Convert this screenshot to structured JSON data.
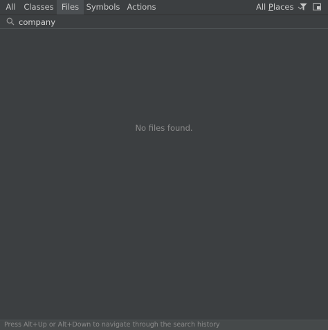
{
  "tabs": [
    {
      "label": "All",
      "selected": false
    },
    {
      "label": "Classes",
      "selected": false
    },
    {
      "label": "Files",
      "selected": true
    },
    {
      "label": "Symbols",
      "selected": false
    },
    {
      "label": "Actions",
      "selected": false
    }
  ],
  "scope": {
    "prefix": "All ",
    "underlined": "P",
    "suffix": "laces"
  },
  "toolbar": {
    "filter_icon": "filter-icon",
    "preview_icon": "preview-icon"
  },
  "search": {
    "value": "company",
    "icon": "search-icon"
  },
  "results": {
    "empty_message": "No files found."
  },
  "footer": {
    "hint": "Press Alt+Up or Alt+Down to navigate through the search history"
  },
  "colors": {
    "background": "#3c3f41",
    "selected_tab": "#4b4f52",
    "text": "#c8c8c8",
    "muted_text": "#8c8c8c"
  }
}
